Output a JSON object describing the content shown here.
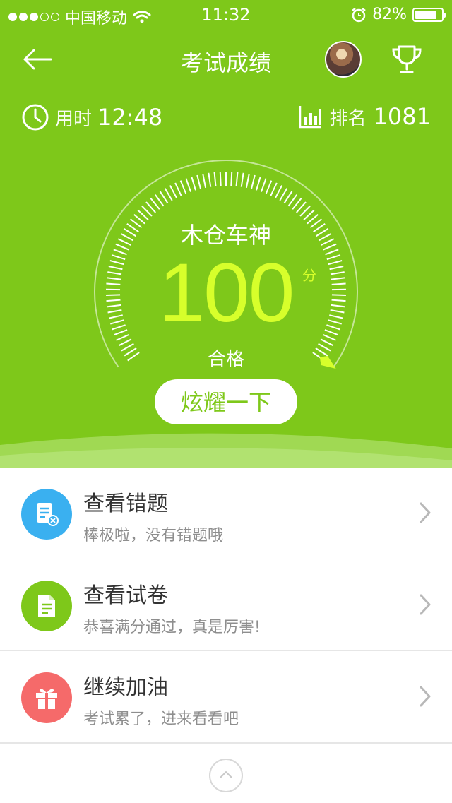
{
  "status_bar": {
    "carrier": "中国移动",
    "time": "11:32",
    "battery": "82%",
    "battery_level": 0.82,
    "signal_bars_filled": 3,
    "signal_bars_total": 5
  },
  "nav": {
    "title": "考试成绩",
    "back_icon": "arrow-left-icon",
    "trophy_icon": "trophy-icon"
  },
  "stats": {
    "time_label": "用时",
    "time_value": "12:48",
    "rank_label": "排名",
    "rank_value": "1081"
  },
  "result": {
    "title": "木仓车神",
    "score": "100",
    "unit": "分",
    "status": "合格",
    "gauge_fraction": 1.0
  },
  "share_button": "炫耀一下",
  "list": [
    {
      "title": "查看错题",
      "subtitle": "棒极啦，没有错题哦",
      "icon": "wrong-questions-icon",
      "color": "#3ab0f0"
    },
    {
      "title": "查看试卷",
      "subtitle": "恭喜满分通过，真是厉害!",
      "icon": "document-icon",
      "color": "#7ec81a"
    },
    {
      "title": "继续加油",
      "subtitle": "考试累了，进来看看吧",
      "icon": "gift-icon",
      "color": "#f56a6a"
    }
  ],
  "colors": {
    "primary": "#7ec81a",
    "score": "#d7ff2b"
  }
}
